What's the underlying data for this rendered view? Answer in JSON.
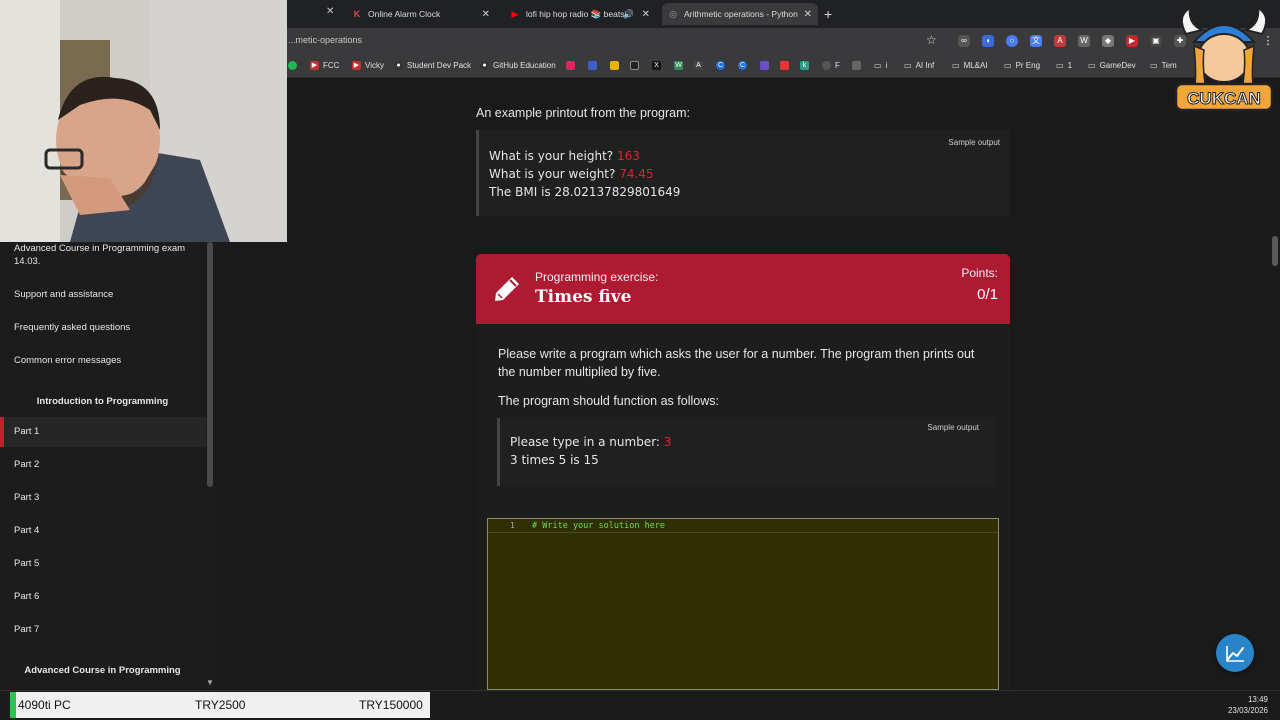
{
  "browser": {
    "tabs": [
      {
        "label": "Online Alarm Clock",
        "icon": "k-icon",
        "color": "#e0444a"
      },
      {
        "label": "lofi hip hop radio 📚 beats",
        "icon": "youtube-icon",
        "color": "#ff0000"
      },
      {
        "label": "Arithmetic operations - Python",
        "icon": "globe-icon",
        "color": "#9aa0a6"
      }
    ],
    "url": "...metic-operations",
    "bookmarks": [
      "FCC",
      "Vicky",
      "Student Dev Pack",
      "GitHub Education",
      "F",
      "i",
      "AI Inf",
      "ML&AI",
      "Pr Eng",
      "1",
      "GameDev",
      "Tem"
    ]
  },
  "sidebar": {
    "items_top": [
      {
        "label": "Advanced Course in Programming exam 14.03."
      },
      {
        "label": "Support and assistance"
      },
      {
        "label": "Frequently asked questions"
      },
      {
        "label": "Common error messages"
      }
    ],
    "section1": "Introduction to Programming",
    "parts": [
      "Part 1",
      "Part 2",
      "Part 3",
      "Part 4",
      "Part 5",
      "Part 6",
      "Part 7"
    ],
    "active_part": "Part 1",
    "section2": "Advanced Course in Programming"
  },
  "content": {
    "lead": "An example printout from the program:",
    "sample1": {
      "label": "Sample output",
      "lines": [
        {
          "text": "What is your height? ",
          "input": "163"
        },
        {
          "text": "What is your weight? ",
          "input": "74.45"
        },
        {
          "text": "The BMI is 28.02137829801649",
          "input": ""
        }
      ]
    },
    "exercise": {
      "kicker": "Programming exercise:",
      "title": "Times five",
      "points_label": "Points:",
      "points": "0/1",
      "description": "Please write a program which asks the user for a number. The program then prints out the number multiplied by five.",
      "instruction": "The program should function as follows:",
      "sample": {
        "label": "Sample output",
        "prompt": "Please type in a number: ",
        "input": "3",
        "result": "3 times 5 is 15"
      },
      "editor": {
        "line_number": "1",
        "code": "# Write your solution here"
      }
    }
  },
  "overlay": {
    "logo_text": "CUKCAN"
  },
  "taskbar": {
    "ticker": [
      "4090ti PC",
      "TRY2500",
      "TRY150000"
    ],
    "time": "13:49",
    "date": "23/03/2026"
  },
  "colors": {
    "accent": "#ae1a32",
    "input_red": "#d8262e",
    "fab": "#2a84c9",
    "ticker_green": "#28c850"
  }
}
